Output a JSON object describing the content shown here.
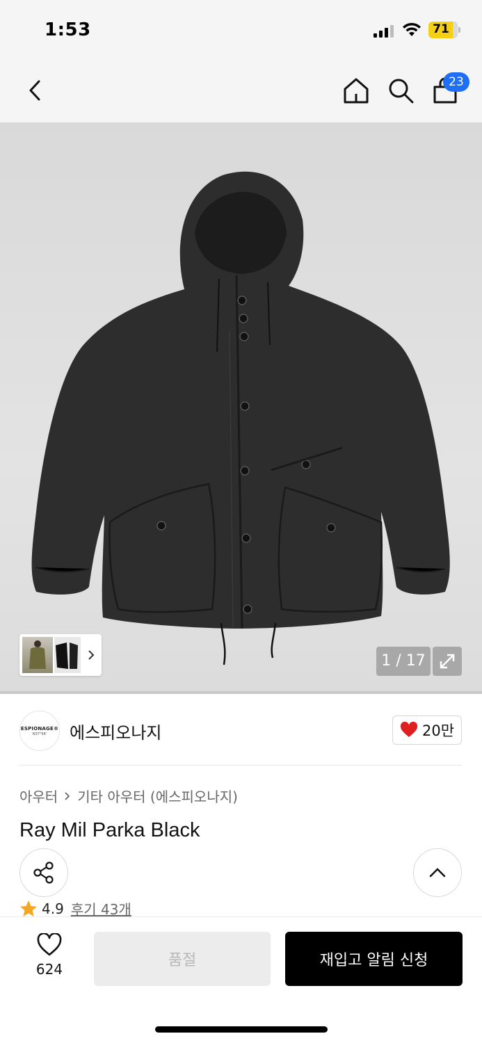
{
  "status_bar": {
    "time": "1:53",
    "battery": "71",
    "icons": [
      "signal-icon",
      "wifi-icon",
      "battery-icon"
    ]
  },
  "nav": {
    "icons": [
      "back-icon",
      "home-icon",
      "search-icon",
      "cart-icon"
    ],
    "cart_badge": "23"
  },
  "gallery": {
    "counter": "1 / 17",
    "icons": [
      "chevron-right-icon",
      "expand-icon"
    ]
  },
  "brand": {
    "logo_line1": "ESPIONAGE®",
    "logo_line2": "N37°56'",
    "name": "에스피오나지",
    "like_count": "20만",
    "icons": [
      "heart-filled-icon"
    ],
    "heart_color": "#e02020"
  },
  "product": {
    "breadcrumb": [
      "아우터",
      "기타 아우터 (에스피오나지)"
    ],
    "title": "Ray Mil Parka Black",
    "rating": "4.9",
    "review_link": "후기 43개",
    "icons": [
      "share-icon",
      "scroll-top-icon",
      "star-icon"
    ],
    "star_color": "#f5a623"
  },
  "bottom_bar": {
    "wish_count": "624",
    "soldout_label": "품절",
    "restock_label": "재입고 알림 신청",
    "icons": [
      "heart-outline-icon"
    ]
  }
}
